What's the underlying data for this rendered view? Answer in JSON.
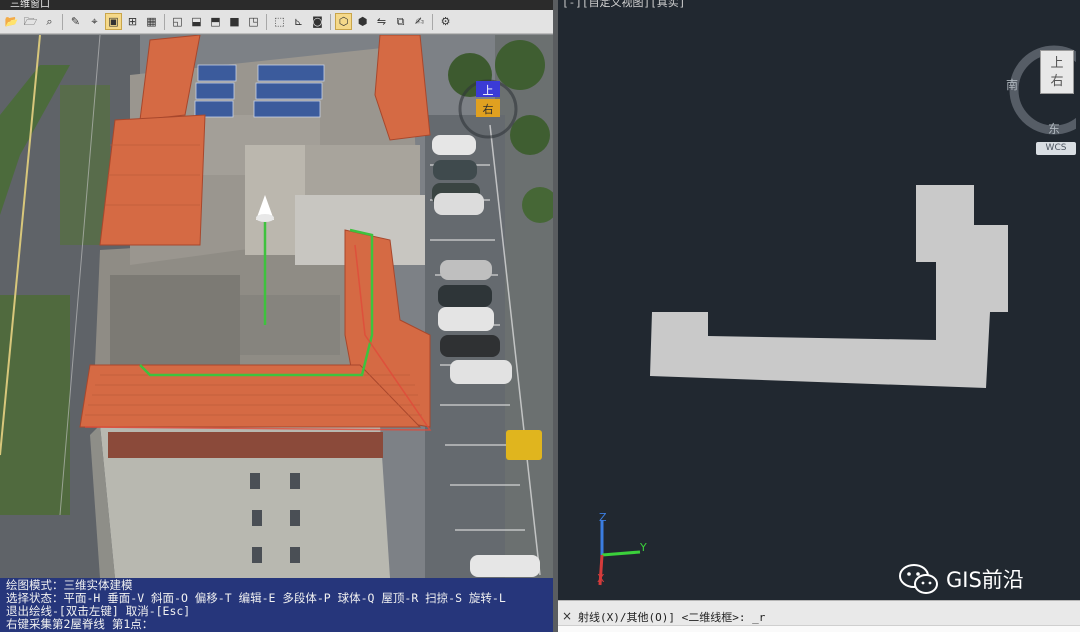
{
  "left_window": {
    "title": "三维窗口",
    "toolbar": [
      {
        "icon": "open-folder-icon",
        "active": false
      },
      {
        "icon": "save-folder-icon",
        "active": false
      },
      {
        "icon": "inspect-icon",
        "active": false
      },
      {
        "icon": "wand-icon",
        "active": false
      },
      {
        "icon": "node-edit-icon",
        "active": false
      },
      {
        "icon": "solid-box-icon",
        "active": true
      },
      {
        "icon": "grid-select-icon",
        "active": false
      },
      {
        "icon": "grid-icon",
        "active": false
      },
      {
        "icon": "layer-icon",
        "active": false
      },
      {
        "icon": "layer-down-icon",
        "active": false
      },
      {
        "icon": "layer-up-icon",
        "active": false
      },
      {
        "icon": "gray-square-icon",
        "active": false
      },
      {
        "icon": "layer-swap-icon",
        "active": false
      },
      {
        "icon": "model-cube-icon",
        "active": false
      },
      {
        "icon": "measure-icon",
        "active": false
      },
      {
        "icon": "camera-icon",
        "active": false
      },
      {
        "icon": "cube-active-icon",
        "active": true
      },
      {
        "icon": "cube-outline-icon",
        "active": false
      },
      {
        "icon": "flip-icon",
        "active": false
      },
      {
        "icon": "copy-layer-icon",
        "active": false
      },
      {
        "icon": "edit-note-icon",
        "active": false
      },
      {
        "icon": "settings-gear-icon",
        "active": false
      }
    ],
    "scene": {
      "direction_marker_top": "上",
      "direction_marker_right": "右"
    },
    "command_lines": [
      "绘图模式：三维实体建模",
      "选择状态：平面-H 垂面-V 斜面-O 偏移-T 编辑-E 多段体-P 球体-Q 屋顶-R 扫掠-S 旋转-L",
      "退出绘线-[双击左键] 取消-[Esc]",
      "右键采集第2屋脊线 第1点："
    ]
  },
  "right_window": {
    "viewport_label": "[-][自定义视图][真实]",
    "viewcube": {
      "face_top": "上",
      "face_front": "右",
      "compass_south": "南",
      "compass_east": "东",
      "wcs_label": "WCS"
    },
    "ucs_labels": {
      "z": "Z",
      "y": "Y",
      "x": "X"
    },
    "command_prompt": "射线(X)/其他(O)] <二维线框>: _r",
    "command_close": "×",
    "building_fill": "#c9c9c9",
    "background": "#212830"
  },
  "watermark": {
    "text": "GIS前沿"
  },
  "colors": {
    "command_panel_bg": "#26367b",
    "roof_tile": "#d56a44",
    "selection_green": "#3ec23e",
    "selection_red": "#e04a3a"
  }
}
